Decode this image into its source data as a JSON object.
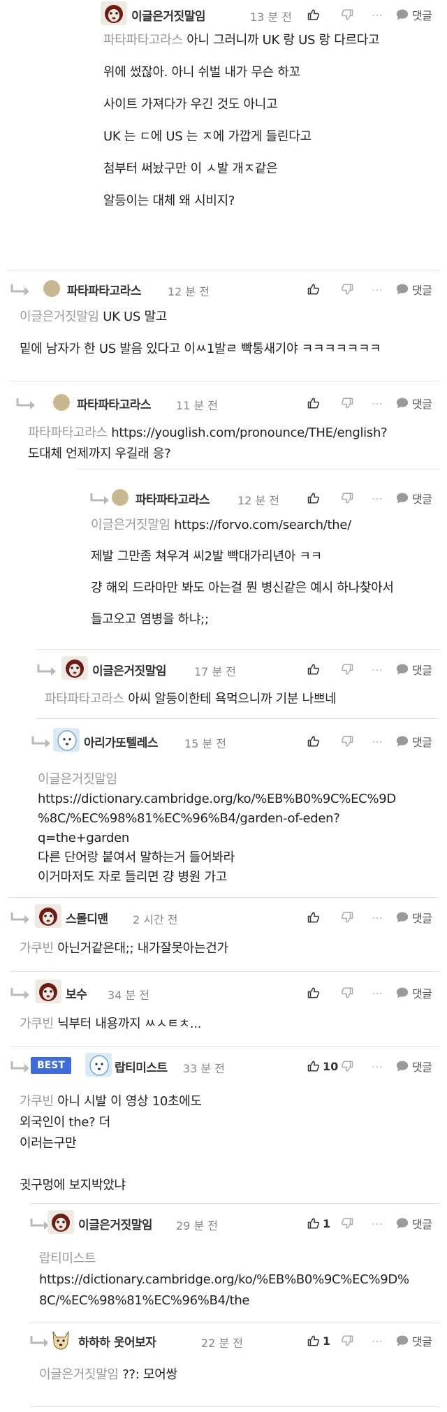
{
  "actions": {
    "reply_label": "댓글",
    "more_label": "⋯"
  },
  "comments": [
    {
      "nickname": "이글은거짓말임",
      "time": "13 분 전",
      "likes": "",
      "avatar": "dog-face-icon",
      "lines": [
        {
          "tag": "파타파타고라스",
          "text": " 아니 그러니까 UK 랑 US 랑 다르다고"
        },
        {
          "tag": "",
          "text": "위에 썼잖아. 아니 쉬벌 내가 무슨 하꼬"
        },
        {
          "tag": "",
          "text": "사이트 가져다가 우긴 것도 아니고"
        },
        {
          "tag": "",
          "text": "UK 는 ㄷ에 US 는 ㅈ에 가깝게 들린다고"
        },
        {
          "tag": "",
          "text": "첨부터 써놨구만 이 ㅅ발 개ㅈ같은"
        },
        {
          "tag": "",
          "text": "알등이는 대체 왜 시비지?"
        }
      ]
    },
    {
      "nickname": "파타파타고라스",
      "time": "12 분 전",
      "likes": "",
      "avatar": "default-avatar-icon",
      "lines": [
        {
          "tag": "이글은거짓말임",
          "text": " UK US 말고"
        },
        {
          "tag": "",
          "text": "밑에 남자가 한 US 발음 있다고 이ㅆ1발ㄹ 빡통새기야 ㅋㅋㅋㅋㅋㅋㅋ"
        }
      ]
    },
    {
      "nickname": "파타파타고라스",
      "time": "11 분 전",
      "likes": "",
      "avatar": "default-avatar-icon",
      "lines": [
        {
          "tag": "파타파타고라스",
          "text": " https://youglish.com/pronounce/THE/english?"
        },
        {
          "tag": "",
          "text": "도대체 언제까지 우길래 응?"
        }
      ]
    },
    {
      "nickname": "파타파타고라스",
      "time": "12 분 전",
      "likes": "",
      "avatar": "default-avatar-icon",
      "lines": [
        {
          "tag": "이글은거짓말임",
          "text": " https://forvo.com/search/the/"
        },
        {
          "tag": "",
          "text": "제발 그만좀 쳐우겨 씨2발 빡대가리년아 ㅋㅋ"
        },
        {
          "tag": "",
          "text": "걍 해외 드라마만 봐도 아는걸 뭔 병신같은 예시 하나찾아서"
        },
        {
          "tag": "",
          "text": "들고오고 염병을 하냐;;"
        }
      ]
    },
    {
      "nickname": "이글은거짓말임",
      "time": "17 분 전",
      "likes": "",
      "avatar": "dog-face-icon",
      "lines": [
        {
          "tag": "파타파타고라스",
          "text": " 아씨 알등이한테 욕먹으니까 기분 나쁘네"
        }
      ]
    },
    {
      "nickname": "아리가또텔레스",
      "time": "15 분 전",
      "likes": "",
      "avatar": "white-dog-icon",
      "lines": [
        {
          "tag": "이글은거짓말임",
          "text": ""
        },
        {
          "tag": "",
          "text": "https://dictionary.cambridge.org/ko/%EB%B0%9C%EC%9D"
        },
        {
          "tag": "",
          "text": "%8C/%EC%98%81%EC%96%B4/garden-of-eden?"
        },
        {
          "tag": "",
          "text": "q=the+garden"
        },
        {
          "tag": "",
          "text": "다른 단어랑 붙여서 말하는거 들어봐라"
        },
        {
          "tag": "",
          "text": "이거마저도 자로 들리면 걍 병원 가고"
        }
      ]
    },
    {
      "nickname": "스몰디맨",
      "time": "2 시간 전",
      "likes": "",
      "avatar": "dog-face-icon",
      "lines": [
        {
          "tag": "가쿠빈",
          "text": " 아닌거같은대;; 내가잘못아는건가"
        }
      ]
    },
    {
      "nickname": "보수",
      "time": "34 분 전",
      "likes": "",
      "avatar": "dog-face-icon",
      "lines": [
        {
          "tag": "가쿠빈",
          "text": " 닉부터 내용까지 ㅆㅅㅌㅊ..."
        }
      ]
    },
    {
      "nickname": "랍티미스트",
      "time": "33 분 전",
      "likes": "10",
      "badge": "BEST",
      "avatar": "white-dog-icon",
      "lines": [
        {
          "tag": "가쿠빈",
          "text": " 아니 시발 이 영상 10초에도"
        },
        {
          "tag": "",
          "text": "외국인이 the? 더"
        },
        {
          "tag": "",
          "text": "이러는구만"
        },
        {
          "tag": "",
          "text": ""
        },
        {
          "tag": "",
          "text": "귓구멍에 보지박았냐"
        }
      ]
    },
    {
      "nickname": "이글은거짓말임",
      "time": "29 분 전",
      "likes": "1",
      "avatar": "dog-face-icon",
      "lines": [
        {
          "tag": "랍티미스트",
          "text": ""
        },
        {
          "tag": "",
          "text": "https://dictionary.cambridge.org/ko/%EB%B0%9C%EC%9D%"
        },
        {
          "tag": "",
          "text": "8C/%EC%98%81%EC%96%B4/the"
        }
      ]
    },
    {
      "nickname": "하하하 웃어보자",
      "time": "22 분 전",
      "likes": "1",
      "avatar": "shiba-dog-icon",
      "lines": [
        {
          "tag": "이글은거짓말임",
          "text": " ??: 모어쌍"
        }
      ]
    }
  ]
}
